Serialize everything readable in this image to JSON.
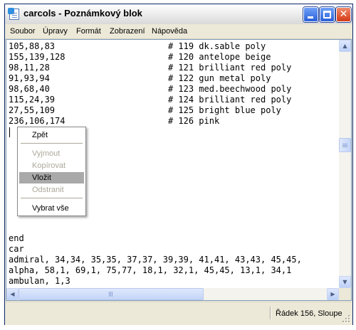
{
  "window": {
    "title": "carcols - Poznámkový blok",
    "buttons": {
      "minimize": "minimize",
      "maximize": "maximize",
      "close": "✕"
    }
  },
  "menu": [
    "Soubor",
    "Úpravy",
    "Formát",
    "Zobrazení",
    "Nápověda"
  ],
  "editor": {
    "lines": [
      "105,88,83                      # 119 dk.sable poly",
      "155,139,128                    # 120 antelope beige",
      "98,11,28                       # 121 brilliant red poly",
      "91,93,94                       # 122 gun metal poly",
      "98,68,40                       # 123 med.beechwood poly",
      "115,24,39                      # 124 brilliant red poly",
      "27,55,109                      # 125 bright blue poly",
      "236,106,174                    # 126 pink",
      "",
      "",
      "",
      "",
      "",
      "",
      "",
      "",
      "",
      "",
      "end",
      "car",
      "admiral, 34,34, 35,35, 37,37, 39,39, 41,41, 43,43, 45,45,",
      "alpha, 58,1, 69,1, 75,77, 18,1, 32,1, 45,45, 13,1, 34,1",
      "ambulan, 1,3"
    ]
  },
  "context_menu": {
    "items": [
      {
        "label": "Zpět",
        "enabled": true
      },
      {
        "separator": true
      },
      {
        "label": "Vyjmout",
        "enabled": false
      },
      {
        "label": "Kopírovat",
        "enabled": false
      },
      {
        "label": "Vložit",
        "enabled": true,
        "highlighted": true
      },
      {
        "label": "Odstranit",
        "enabled": false
      },
      {
        "separator": true
      },
      {
        "label": "Vybrat vše",
        "enabled": true
      }
    ]
  },
  "scrollbars": {
    "up_arrow": "▲",
    "down_arrow": "▼",
    "left_arrow": "◀",
    "right_arrow": "▶"
  },
  "status": {
    "position": "Řádek 156, Sloupe"
  },
  "colors": {
    "title_gradient_top": "#ffffff",
    "close_button": "#d33a16",
    "button_blue": "#2a5fd8",
    "highlight": "#a9a9a9"
  }
}
